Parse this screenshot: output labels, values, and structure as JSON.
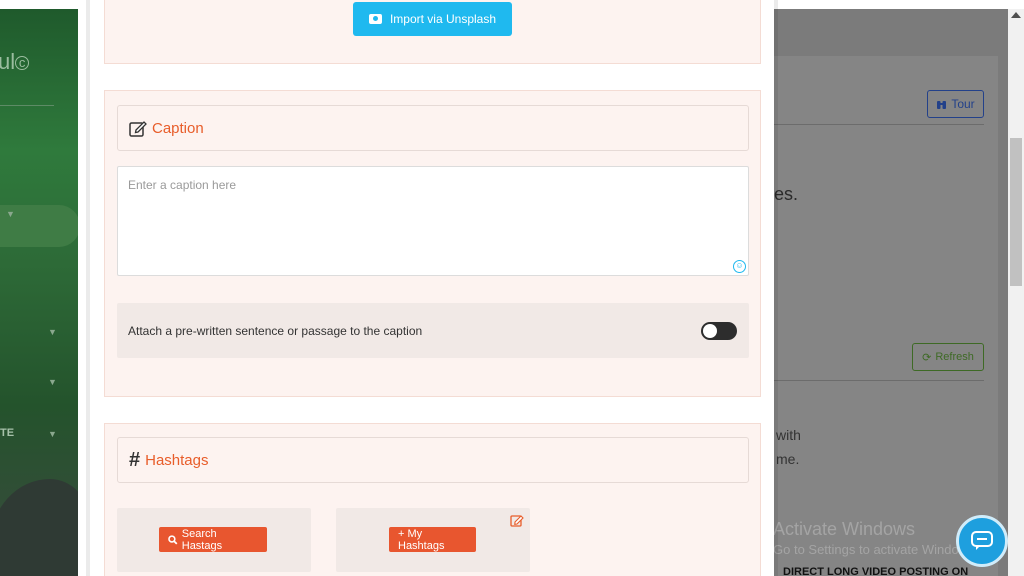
{
  "background": {
    "sidebar": {
      "logo_text": "ul",
      "logo_mark": "c",
      "menu_fragment": "TE"
    },
    "header": {
      "tour_label": "Tour"
    },
    "content": {
      "fragment_es": "es.",
      "refresh_label": "Refresh",
      "fragment_with": "with",
      "fragment_me": "me."
    },
    "watermark": {
      "line1": "Activate Windows",
      "line2": "Go to Settings to activate Windows."
    },
    "footer_text": "DIRECT LONG VIDEO POSTING ON"
  },
  "modal": {
    "import_button": {
      "label": "Import via Unsplash",
      "icon": "camera-icon"
    },
    "caption_section": {
      "title": "Caption",
      "icon": "edit-icon",
      "placeholder": "Enter a caption here",
      "value": "",
      "attach_label": "Attach a pre-written sentence or passage to the caption",
      "attach_enabled": false
    },
    "hashtags_section": {
      "title": "Hashtags",
      "icon": "hash-icon",
      "search_button": "Search Hastags",
      "my_hashtags_button": "+ My Hashtags"
    }
  },
  "colors": {
    "accent_orange": "#e85d2a",
    "button_orange": "#e8562f",
    "import_blue": "#1fb9ef",
    "panel_bg": "#fdf3f0",
    "chat_blue": "#1e9fde"
  }
}
